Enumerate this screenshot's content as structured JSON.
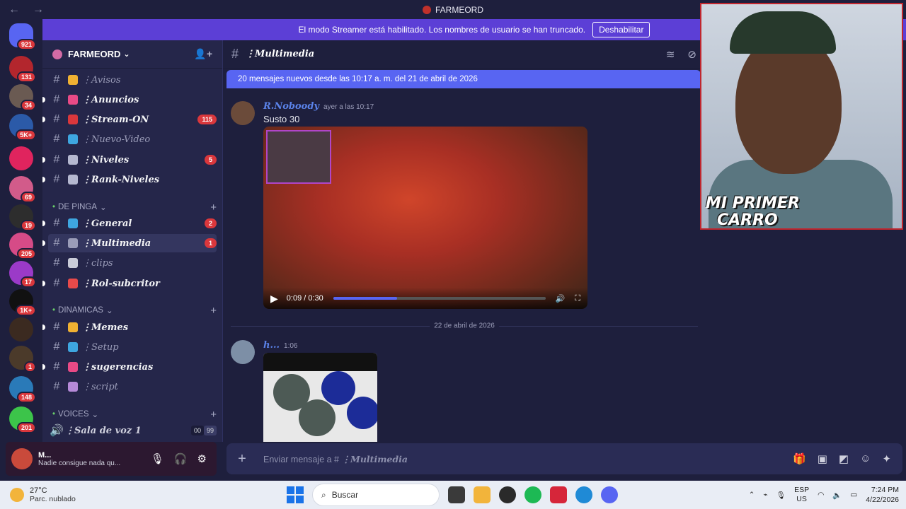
{
  "window": {
    "title": "FARMEORD",
    "back_icon": "←",
    "forward_icon": "→"
  },
  "streamer_bar": {
    "text": "El modo Streamer está habilitado. Los nombres de usuario se han truncado.",
    "button": "Deshabilitar"
  },
  "guilds": [
    {
      "badge": "921",
      "color": "#5865f2"
    },
    {
      "badge": "131",
      "color": "#b3262d"
    },
    {
      "badge": "34",
      "color": "#6a5a52"
    },
    {
      "badge": "5K+",
      "color": "#2b5aa8"
    },
    {
      "badge": "",
      "color": "#e0245e"
    },
    {
      "badge": "69",
      "color": "#d25b8a"
    },
    {
      "badge": "19",
      "color": "#2d2d2d"
    },
    {
      "badge": "205",
      "color": "#d64b87"
    },
    {
      "badge": "17",
      "color": "#9b3ac8"
    },
    {
      "badge": "1K+",
      "color": "#111111"
    },
    {
      "badge": "",
      "color": "#3b2a20"
    },
    {
      "badge": "1",
      "color": "#4b3a2a"
    },
    {
      "badge": "148",
      "color": "#2a7ab8"
    },
    {
      "badge": "201",
      "color": "#3cc44a"
    }
  ],
  "server": {
    "name": "FARMEORD",
    "chevron": "⌄",
    "invite_icon": "👤+"
  },
  "channels": [
    {
      "name": "⋮Avisos",
      "muted": true,
      "count": "",
      "emoji_color": "#f0b132"
    },
    {
      "name": "⋮Anuncios",
      "muted": false,
      "count": "",
      "emoji_color": "#e94a86"
    },
    {
      "name": "⋮Stream-ON",
      "muted": false,
      "count": "115",
      "emoji_color": "#da373c"
    },
    {
      "name": "⋮Nuevo-Video",
      "muted": true,
      "count": "",
      "emoji_color": "#3ea6e0"
    },
    {
      "name": "⋮Niveles",
      "muted": false,
      "count": "5",
      "emoji_color": "#b5b8d0"
    },
    {
      "name": "⋮Rank-Niveles",
      "muted": false,
      "count": "",
      "emoji_color": "#b5b8d0"
    }
  ],
  "categories": [
    {
      "name": "DE PINGA",
      "chevron": "⌄",
      "plus": "+"
    },
    {
      "name": "DINAMICAS",
      "chevron": "⌄",
      "plus": "+"
    },
    {
      "name": "VOICES",
      "chevron": "⌄",
      "plus": "+"
    }
  ],
  "channels_cat1": [
    {
      "name": "⋮General",
      "muted": false,
      "count": "2",
      "emoji_color": "#3ea6e0"
    },
    {
      "name": "⋮Multimedia",
      "muted": false,
      "count": "1",
      "emoji_color": "#9a9cb8"
    },
    {
      "name": "⋮clips",
      "muted": true,
      "count": "",
      "emoji_color": "#c9ccd8"
    },
    {
      "name": "⋮Rol-subcritor",
      "muted": false,
      "count": "",
      "emoji_color": "#e94a4a"
    }
  ],
  "channels_cat2": [
    {
      "name": "⋮Memes",
      "muted": false,
      "count": "",
      "emoji_color": "#f0b132"
    },
    {
      "name": "⋮Setup",
      "muted": true,
      "count": "",
      "emoji_color": "#3ea6e0"
    },
    {
      "name": "⋮sugerencias",
      "muted": false,
      "count": "",
      "emoji_color": "#e94a86"
    },
    {
      "name": "⋮script",
      "muted": true,
      "count": "",
      "emoji_color": "#b68ad8"
    }
  ],
  "voice_channel": {
    "name": "⋮Sala de voz 1",
    "users": "00",
    "limit": "99"
  },
  "user": {
    "name": "M...",
    "status": "Nadie consigue nada qu..."
  },
  "chat": {
    "channel": "⋮Multimedia",
    "new_messages": "20 mensajes nuevos desde las 10:17 a. m. del 21 de abril de 2026",
    "messages": [
      {
        "author": "R.Noboody",
        "time": "ayer a las 10:17",
        "text": "Susto 30"
      },
      {
        "author": "h...",
        "time": "1:06",
        "text": ""
      }
    ],
    "video": {
      "time": "0:09 / 0:30",
      "progress": 0.3
    },
    "date_divider": "22 de abril de 2026",
    "composer_placeholder": "Enviar mensaje a #",
    "composer_channel": "⋮Multimedia"
  },
  "webcam_overlay": {
    "line1": "MI PRIMER",
    "line2": "CARRO"
  },
  "taskbar": {
    "temp": "27°C",
    "condition": "Parc. nublado",
    "search_placeholder": "Buscar",
    "lang": "ESP",
    "region": "US",
    "time": "7:24 PM",
    "date": "4/22/2026"
  }
}
